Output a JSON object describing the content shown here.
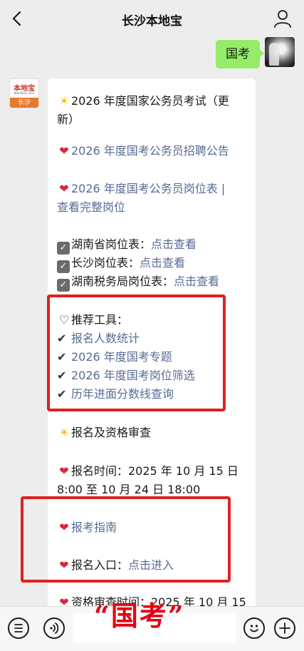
{
  "header": {
    "title": "长沙本地宝"
  },
  "user_message": {
    "text": "国考"
  },
  "bot": {
    "avatar": {
      "logo_text": "本地宝",
      "domain_text": "Bendibao.com",
      "city_text": "长沙"
    },
    "lines": [
      {
        "prefix": "☀",
        "text": "2026 年度国家公务员考试（更"
      },
      {
        "text": "新）"
      },
      {
        "prefix": "❤",
        "text": "2026 年度国考公务员招聘公告"
      },
      {
        "prefix": "❤",
        "text": "2026 年度国考公务员岗位表 |"
      },
      {
        "text": "查看完整岗位"
      },
      {
        "text": "湖南省岗位表：",
        "link": "点击查看"
      },
      {
        "text": "长沙岗位表：",
        "link": "点击查看"
      },
      {
        "text": "湖南税务局岗位表：",
        "link": "点击查看"
      },
      {
        "prefix": "♡",
        "text": "推荐工具："
      },
      {
        "prefix": "✔",
        "text": "报名人数统计"
      },
      {
        "prefix": "✔",
        "text": "2026 年度国考专题"
      },
      {
        "prefix": "✔",
        "text": "2026 年度国考岗位筛选"
      },
      {
        "prefix": "✔",
        "text": "历年进面分数线查询"
      },
      {
        "prefix": "☀",
        "text": "报名及资格审查"
      },
      {
        "prefix": "❤",
        "text": "报名时间：2025 年 10 月 15 日"
      },
      {
        "text": "8:00 至 10 月 24 日 18:00"
      },
      {
        "prefix": "❤",
        "text": "报考指南"
      },
      {
        "prefix": "❤",
        "text": "报名入口：",
        "link": "点击进入"
      },
      {
        "prefix": "❤",
        "text": "资格审查时间：2025 年 10 月 15"
      }
    ]
  },
  "overlay": {
    "text": "“国考”"
  },
  "icons": {
    "back": "back-icon",
    "user": "user-icon",
    "menu": "menu-icon",
    "voice": "voice-icon",
    "emoji": "emoji-icon",
    "plus": "plus-icon"
  },
  "colors": {
    "link": "#576b95",
    "bubble_user": "#95ec69",
    "highlight": "#e02020",
    "overlay": "#e60012"
  }
}
